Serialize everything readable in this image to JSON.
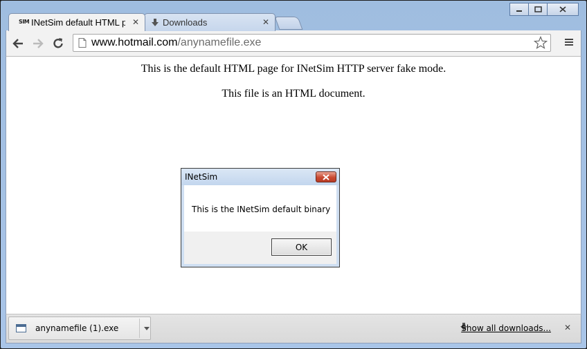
{
  "window": {
    "controls": [
      "minimize",
      "maximize",
      "close"
    ]
  },
  "tabs": [
    {
      "favicon_text": "SIM",
      "title": "INetSim default HTML pag",
      "close": "✕",
      "active": true
    },
    {
      "title": "Downloads",
      "close": "✕",
      "active": false
    }
  ],
  "toolbar": {
    "url_host": "www.hotmail.com",
    "url_path": "/anynamefile.exe"
  },
  "page": {
    "line1": "This is the default HTML page for INetSim HTTP server fake mode.",
    "line2": "This file is an HTML document."
  },
  "dialog": {
    "title": "INetSim",
    "message": "This is the INetSim default binary",
    "ok_label": "OK",
    "close_color": "#c94a32"
  },
  "download_shelf": {
    "item_name": "anynamefile (1).exe",
    "show_all_label": "Show all downloads...",
    "close": "✕"
  }
}
